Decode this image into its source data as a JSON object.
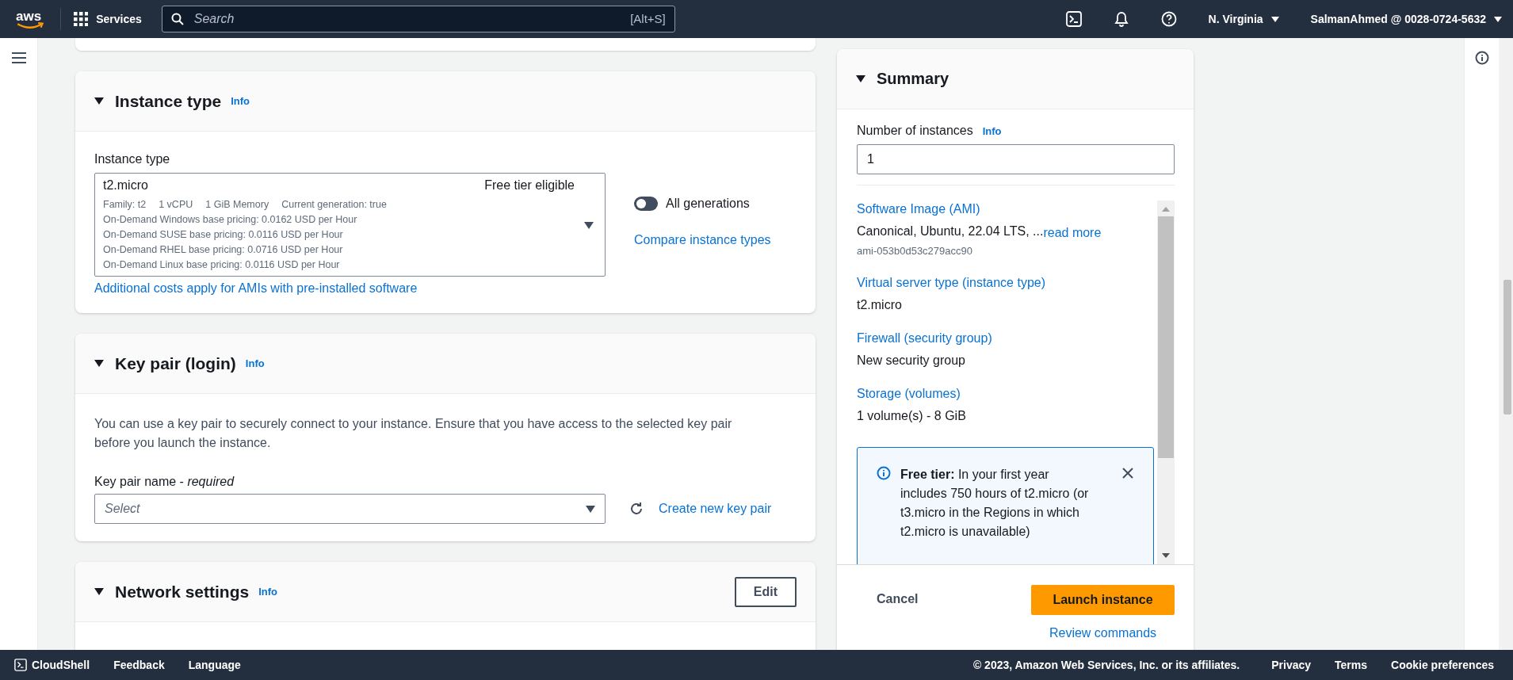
{
  "top_nav": {
    "logo": "aws",
    "services": "Services",
    "search": {
      "placeholder": "Search",
      "shortcut": "[Alt+S]"
    },
    "region": "N. Virginia",
    "account": "SalmanAhmed @ 0028-0724-5632"
  },
  "instance_type": {
    "title": "Instance type",
    "info": "Info",
    "expanded": true,
    "label": "Instance type",
    "select": {
      "value": "t2.micro",
      "badge": "Free tier eligible",
      "specs": [
        "Family: t2",
        "1 vCPU",
        "1 GiB Memory",
        "Current generation: true"
      ],
      "pricing": [
        "On-Demand Windows base pricing: 0.0162 USD per Hour",
        "On-Demand SUSE base pricing: 0.0116 USD per Hour",
        "On-Demand RHEL base pricing: 0.0716 USD per Hour",
        "On-Demand Linux base pricing: 0.0116 USD per Hour"
      ]
    },
    "toggle": {
      "label": "All generations",
      "on": false
    },
    "compare_link": "Compare instance types",
    "costs_link": "Additional costs apply for AMIs with pre-installed software"
  },
  "key_pair": {
    "title": "Key pair (login)",
    "info": "Info",
    "expanded": true,
    "description": "You can use a key pair to securely connect to your instance. Ensure that you have access to the selected key pair before you launch the instance.",
    "label": "Key pair name - *required*",
    "select": {
      "placeholder": "Select"
    },
    "create_link": "Create new key pair"
  },
  "network": {
    "title": "Network settings",
    "info": "Info",
    "expanded": true,
    "edit_button": "Edit"
  },
  "summary": {
    "title": "Summary",
    "expanded": true,
    "instances_label": "Number of instances",
    "info": "Info",
    "instances_value": "1",
    "items": [
      {
        "label": "Software Image (AMI)",
        "value": "Canonical, Ubuntu, 22.04 LTS, ...",
        "link": "read more",
        "sub": "ami-053b0d53c279acc90"
      },
      {
        "label": "Virtual server type (instance type)",
        "value": "t2.micro"
      },
      {
        "label": "Firewall (security group)",
        "value": "New security group"
      },
      {
        "label": "Storage (volumes)",
        "value": "1 volume(s) - 8 GiB"
      }
    ],
    "alert": "**Free tier:** In your first year includes 750 hours of t2.micro (or t3.micro in the Regions in which t2.micro is unavailable)",
    "cancel": "Cancel",
    "launch": "Launch instance",
    "review": "Review commands"
  },
  "footer": {
    "left": [
      "CloudShell",
      "Feedback",
      "Language"
    ],
    "copyright": "© 2023, Amazon Web Services, Inc. or its affiliates.",
    "links": [
      "Privacy",
      "Terms",
      "Cookie preferences"
    ]
  }
}
